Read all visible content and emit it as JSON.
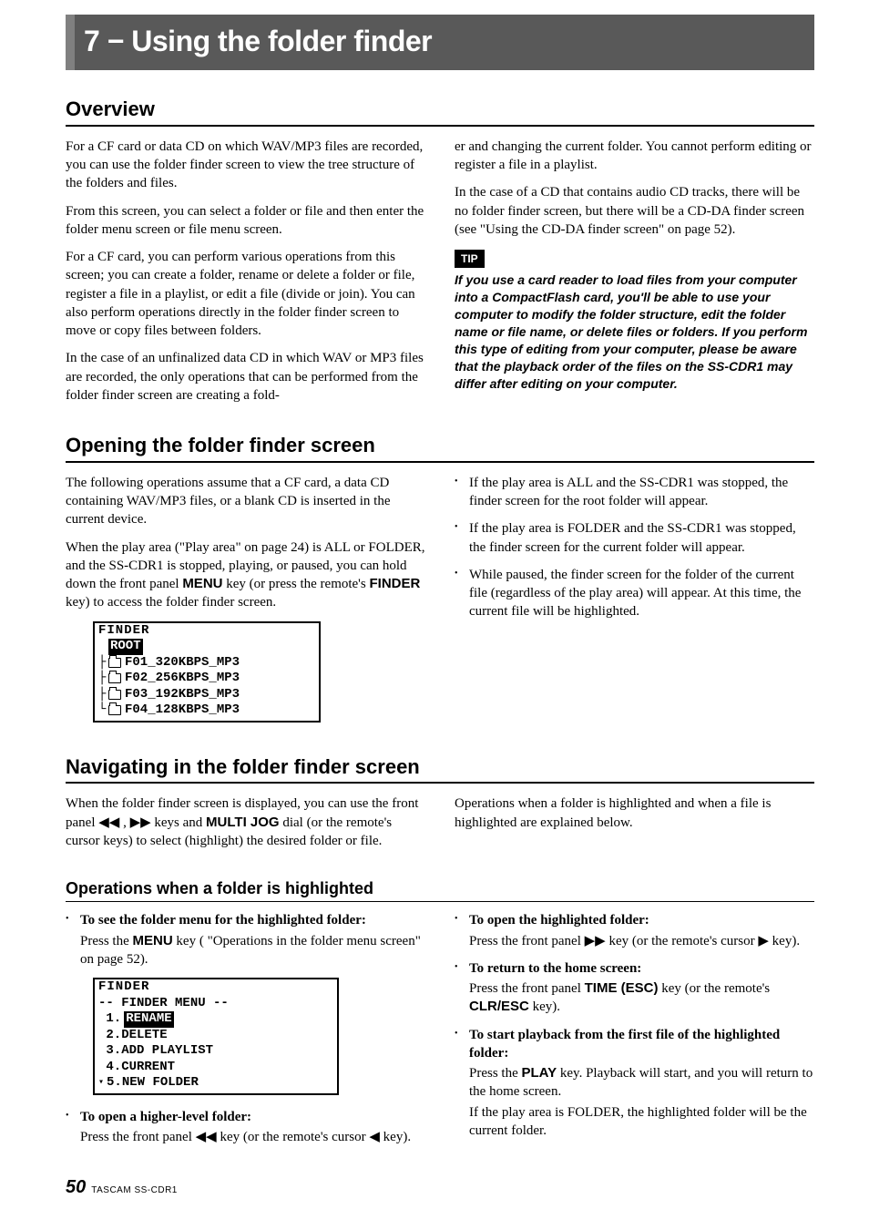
{
  "chapter": {
    "title": "7 − Using the folder finder"
  },
  "overview": {
    "heading": "Overview",
    "left_p1": "For a CF card or data CD on which WAV/MP3 files are recorded, you can use the folder finder screen to view the tree structure of the folders and files.",
    "left_p2": "From this screen, you can select a folder or file and then enter the folder menu screen or file menu screen.",
    "left_p3": "For a CF card, you can perform various operations from this screen; you can create a folder, rename or delete a folder or file, register a file in a playlist, or edit a file (divide or join). You can also perform operations directly in the folder finder screen to move or copy files between folders.",
    "left_p4": "In the case of an unfinalized data CD in which WAV or MP3 files are recorded, the only operations that can be performed from the folder finder screen are creating a fold-",
    "right_p1": "er and changing the current folder. You cannot perform editing or register a file in a playlist.",
    "right_p2": "In the case of a CD that contains audio CD tracks, there will be no folder finder screen, but there will be a CD-DA finder screen (see \"Using the CD-DA finder screen\" on page 52).",
    "tip_label": "TIP",
    "tip_body": "If you use a card reader to load files from your computer into a CompactFlash card, you'll be able to use your computer to modify the folder structure, edit the folder name or file name, or delete files or folders. If you perform this type of editing from your computer, please be aware that the playback order of the files on the SS-CDR1 may differ after editing on your computer."
  },
  "opening": {
    "heading": "Opening the folder finder screen",
    "left_p1": "The following operations assume that a CF card, a data CD containing WAV/MP3 files, or a blank CD is inserted in the current device.",
    "left_p2a": "When the play area (\"Play area\" on page 24) is ALL or FOLDER, and the SS-CDR1 is stopped, playing, or paused, you can hold down the front panel ",
    "left_menu": "MENU",
    "left_p2b": " key (or press the remote's ",
    "left_finder": "FINDER",
    "left_p2c": " key) to access the folder finder screen.",
    "bullets": [
      "If the play area is ALL and the SS-CDR1 was stopped, the finder screen for the root folder will appear.",
      "If the play area is FOLDER and the SS-CDR1 was stopped, the finder screen for the current folder will appear.",
      "While paused, the finder screen for the folder of the current file (regardless of the play area) will appear. At this time, the current file will be highlighted."
    ],
    "screen1": {
      "title": "FINDER",
      "root": "ROOT",
      "rows": [
        "F01_320KBPS_MP3",
        "F02_256KBPS_MP3",
        "F03_192KBPS_MP3",
        "F04_128KBPS_MP3"
      ]
    }
  },
  "navigating": {
    "heading": "Navigating in the folder finder screen",
    "left_p1a": "When the folder finder screen is displayed, you can use the front panel ",
    "left_rew": "◀◀",
    "left_comma": " , ",
    "left_ff": "▶▶",
    "left_p1b": " keys and ",
    "left_jog": "MULTI JOG",
    "left_p1c": " dial (or the remote's cursor keys) to select (highlight) the desired folder or file.",
    "right_p1": "Operations when a folder is highlighted and when a file is highlighted are explained below."
  },
  "ops": {
    "heading": "Operations when a folder is highlighted",
    "left": {
      "b1_title": "To see the folder menu for the highlighted folder:",
      "b1_a": "Press the ",
      "b1_menu": "MENU",
      "b1_b": " key ( \"Operations in the folder menu screen\" on page 52).",
      "b2_title": "To open a higher-level folder:",
      "b2_a": "Press the front panel ",
      "b2_rew": "◀◀",
      "b2_b": " key (or the remote's cursor ",
      "b2_left": "◀",
      "b2_c": " key)."
    },
    "right": {
      "b1_title": "To open the highlighted folder:",
      "b1_a": "Press the front panel ",
      "b1_ff": "▶▶",
      "b1_b": " key (or the remote's cursor ",
      "b1_right": "▶",
      "b1_c": " key).",
      "b2_title": "To return to the home screen:",
      "b2_a": "Press the front panel ",
      "b2_time": "TIME (ESC)",
      "b2_b": " key (or the remote's ",
      "b2_clr": "CLR/ESC",
      "b2_c": " key).",
      "b3_title": "To start playback from the first file of the highlighted folder:",
      "b3_a": "Press the ",
      "b3_play": "PLAY",
      "b3_b": " key. Playback will start, and you will return to the home screen.",
      "b3_c": "If the play area is FOLDER, the highlighted folder will be the current folder."
    },
    "screen2": {
      "title": "FINDER",
      "menuhead": "-- FINDER MENU --",
      "rows": [
        "1.RENAME",
        "2.DELETE",
        "3.ADD PLAYLIST",
        "4.CURRENT",
        "5.NEW FOLDER"
      ],
      "selected_index": 0
    }
  },
  "footer": {
    "page": "50",
    "product": "TASCAM  SS-CDR1"
  }
}
